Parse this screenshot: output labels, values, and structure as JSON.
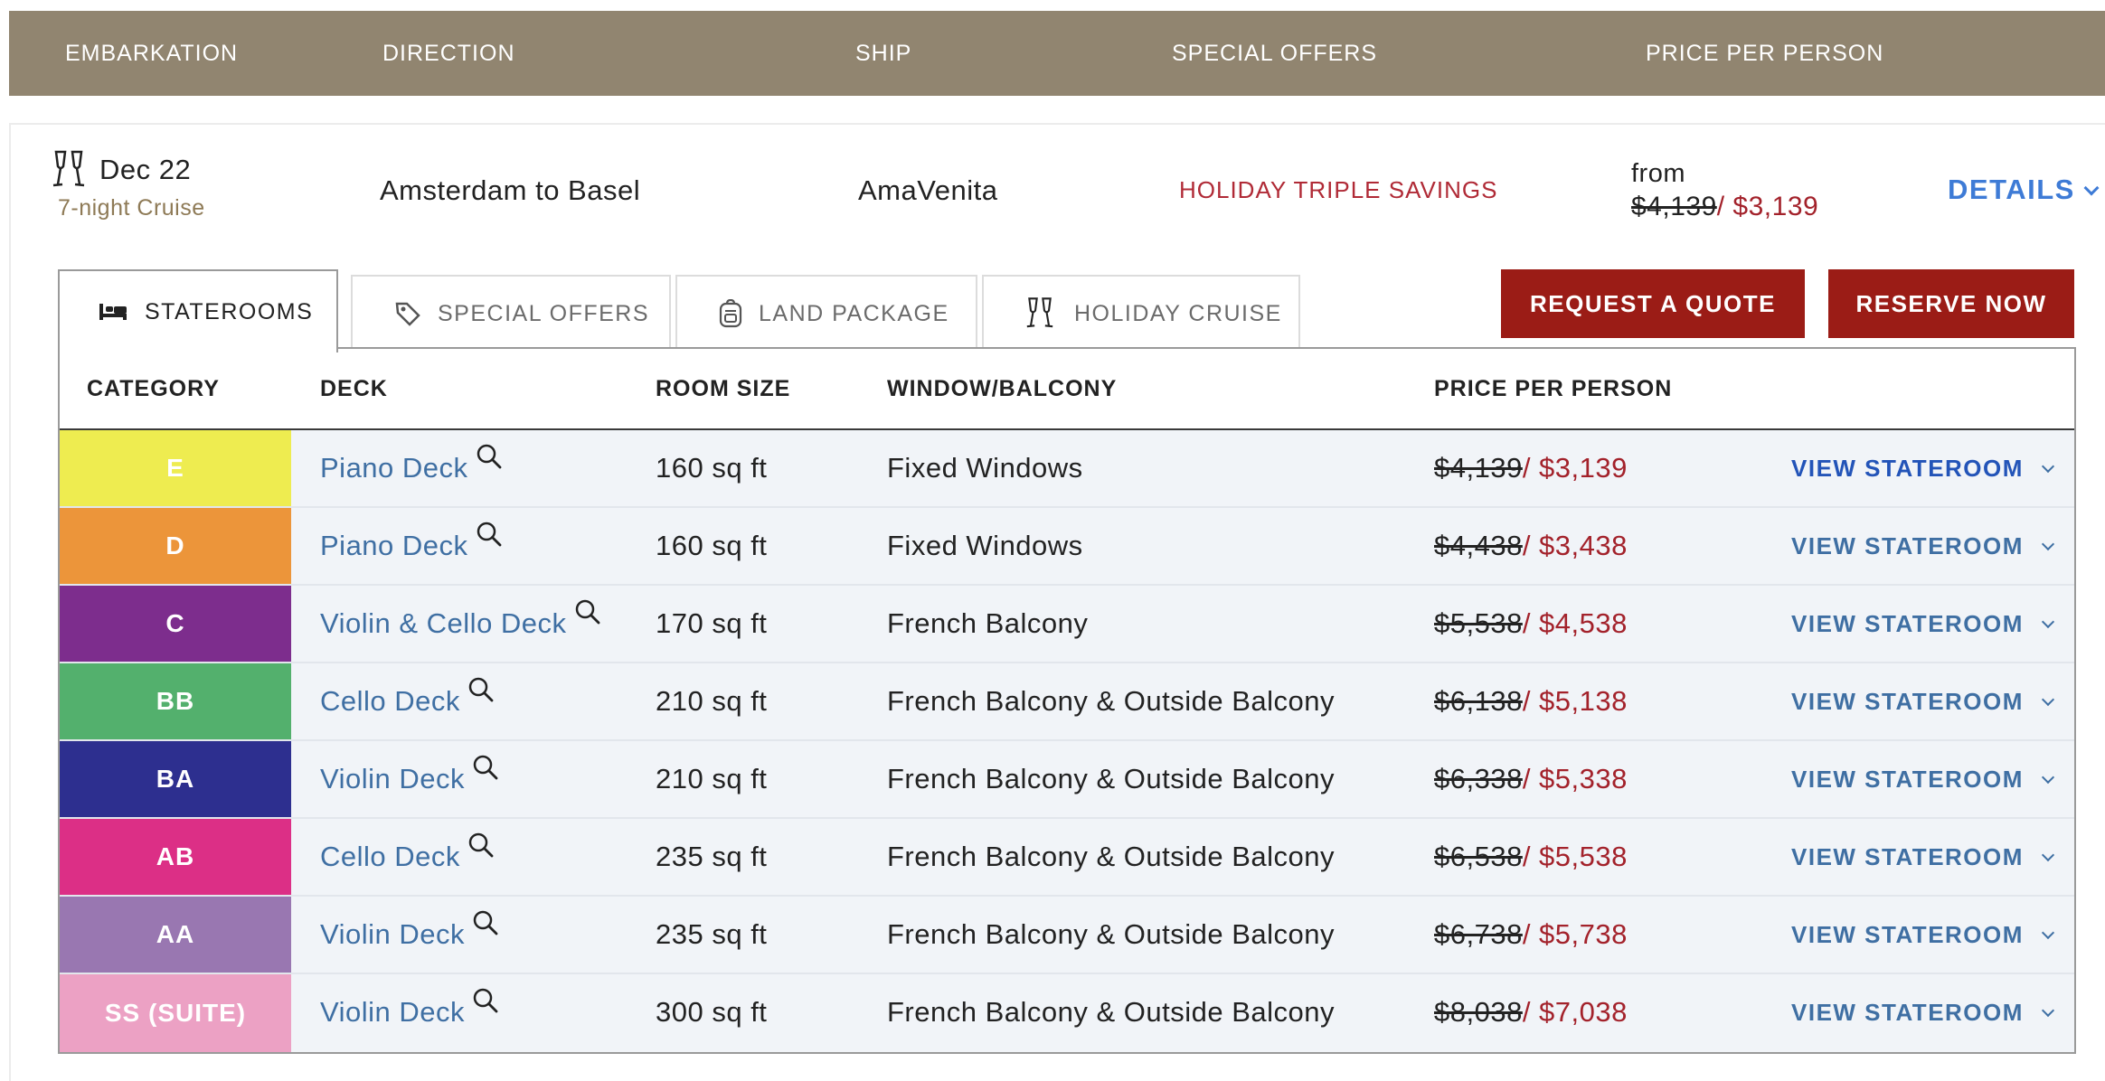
{
  "header": {
    "embarkation": "EMBARKATION",
    "direction": "DIRECTION",
    "ship": "SHIP",
    "special_offers": "SPECIAL OFFERS",
    "price_per_person": "PRICE PER PERSON",
    "background_color": "#918570"
  },
  "cruise": {
    "date": "Dec 22",
    "length": "7-night Cruise",
    "direction": "Amsterdam to Basel",
    "ship": "AmaVenita",
    "offer": "HOLIDAY TRIPLE SAVINGS",
    "price_from": "from",
    "price_old": "$4,139",
    "price_new": "/ $3,139",
    "details": "DETAILS"
  },
  "tabs": [
    {
      "label": "STATEROOMS",
      "icon": "bed-icon",
      "active": true
    },
    {
      "label": "SPECIAL OFFERS",
      "icon": "tag-icon",
      "active": false
    },
    {
      "label": "LAND PACKAGE",
      "icon": "backpack-icon",
      "active": false
    },
    {
      "label": "HOLIDAY CRUISE",
      "icon": "champagne-glasses-icon",
      "active": false
    }
  ],
  "actions": {
    "request_quote": "REQUEST A QUOTE",
    "reserve_now": "RESERVE NOW",
    "button_color": "#9b1c16"
  },
  "table": {
    "headers": {
      "category": "CATEGORY",
      "deck": "DECK",
      "room_size": "ROOM SIZE",
      "window": "WINDOW/BALCONY",
      "price": "PRICE PER PERSON"
    },
    "rows": [
      {
        "category": "E",
        "color": "#eeec50",
        "deck": "Piano Deck",
        "size": "160 sq ft",
        "window": "Fixed Windows",
        "price_old": "$4,139",
        "price_new": "/ $3,139",
        "action": "VIEW STATEROOM"
      },
      {
        "category": "D",
        "color": "#ec953a",
        "deck": "Piano Deck",
        "size": "160 sq ft",
        "window": "Fixed Windows",
        "price_old": "$4,438",
        "price_new": "/ $3,438",
        "action": "VIEW STATEROOM"
      },
      {
        "category": "C",
        "color": "#7d2d8d",
        "deck": "Violin & Cello Deck",
        "size": "170 sq ft",
        "window": "French Balcony",
        "price_old": "$5,538",
        "price_new": "/ $4,538",
        "action": "VIEW STATEROOM"
      },
      {
        "category": "BB",
        "color": "#53b06d",
        "deck": "Cello Deck",
        "size": "210 sq ft",
        "window": "French Balcony & Outside Balcony",
        "price_old": "$6,138",
        "price_new": "/ $5,138",
        "action": "VIEW STATEROOM"
      },
      {
        "category": "BA",
        "color": "#2d2f8f",
        "deck": "Violin Deck",
        "size": "210 sq ft",
        "window": "French Balcony & Outside Balcony",
        "price_old": "$6,338",
        "price_new": "/ $5,338",
        "action": "VIEW STATEROOM"
      },
      {
        "category": "AB",
        "color": "#dc2f86",
        "deck": "Cello Deck",
        "size": "235 sq ft",
        "window": "French Balcony & Outside Balcony",
        "price_old": "$6,538",
        "price_new": "/ $5,538",
        "action": "VIEW STATEROOM"
      },
      {
        "category": "AA",
        "color": "#9977b1",
        "deck": "Violin Deck",
        "size": "235 sq ft",
        "window": "French Balcony & Outside Balcony",
        "price_old": "$6,738",
        "price_new": "/ $5,738",
        "action": "VIEW STATEROOM"
      },
      {
        "category": "SS (SUITE)",
        "color": "#eca1c4",
        "deck": "Violin Deck",
        "size": "300 sq ft",
        "window": "French Balcony & Outside Balcony",
        "price_old": "$8,038",
        "price_new": "/ $7,038",
        "action": "VIEW STATEROOM"
      }
    ]
  }
}
